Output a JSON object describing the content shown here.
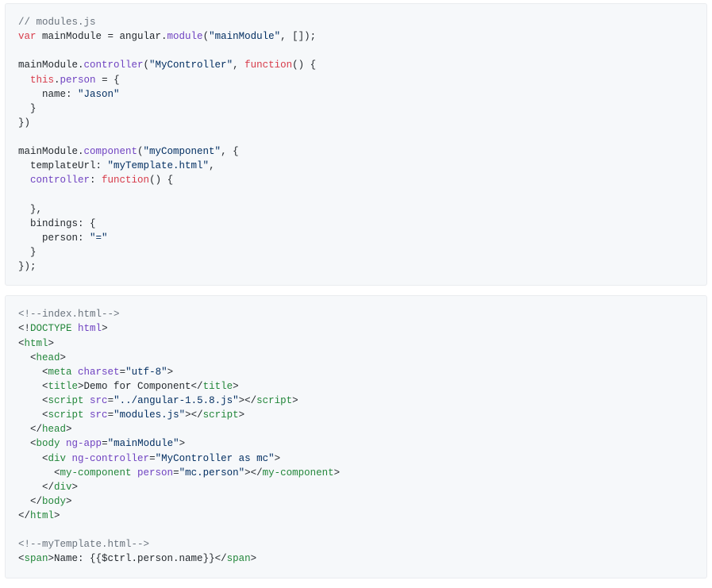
{
  "block1": {
    "l1_comment": "// modules.js",
    "l2_kw": "var",
    "l2_a": " mainModule = angular.",
    "l2_fn": "module",
    "l2_b": "(",
    "l2_s1": "\"mainModule\"",
    "l2_c": ", []);",
    "l3": "",
    "l4_a": "mainModule.",
    "l4_fn": "controller",
    "l4_b": "(",
    "l4_s1": "\"MyController\"",
    "l4_c": ", ",
    "l4_kw": "function",
    "l4_d": "() {",
    "l5_a": "  ",
    "l5_kw": "this",
    "l5_b": ".",
    "l5_attr": "person",
    "l5_c": " = {",
    "l6_a": "    name: ",
    "l6_s1": "\"Jason\"",
    "l7": "  }",
    "l8": "})",
    "l9": "",
    "l10_a": "mainModule.",
    "l10_fn": "component",
    "l10_b": "(",
    "l10_s1": "\"myComponent\"",
    "l10_c": ", {",
    "l11_a": "  templateUrl: ",
    "l11_s1": "\"myTemplate.html\"",
    "l11_b": ",",
    "l12_a": "  ",
    "l12_attr": "controller",
    "l12_b": ": ",
    "l12_kw": "function",
    "l12_c": "() {",
    "l13": "",
    "l14": "  },",
    "l15": "  bindings: {",
    "l16_a": "    person: ",
    "l16_s1": "\"=\"",
    "l17": "  }",
    "l18": "});"
  },
  "block2": {
    "l1_comment": "<!--index.html-->",
    "l2_a": "<!",
    "l2_tag": "DOCTYPE",
    "l2_b": " ",
    "l2_attr": "html",
    "l2_c": ">",
    "l3_a": "<",
    "l3_tag": "html",
    "l3_b": ">",
    "l4_a": "  <",
    "l4_tag": "head",
    "l4_b": ">",
    "l5_a": "    <",
    "l5_tag": "meta",
    "l5_b": " ",
    "l5_attr": "charset",
    "l5_c": "=",
    "l5_s1": "\"utf-8\"",
    "l5_d": ">",
    "l6_a": "    <",
    "l6_tag": "title",
    "l6_b": ">Demo for Component</",
    "l6_tag2": "title",
    "l6_c": ">",
    "l7_a": "    <",
    "l7_tag": "script",
    "l7_b": " ",
    "l7_attr": "src",
    "l7_c": "=",
    "l7_s1": "\"../angular-1.5.8.js\"",
    "l7_d": "></",
    "l7_tag2": "script",
    "l7_e": ">",
    "l8_a": "    <",
    "l8_tag": "script",
    "l8_b": " ",
    "l8_attr": "src",
    "l8_c": "=",
    "l8_s1": "\"modules.js\"",
    "l8_d": "></",
    "l8_tag2": "script",
    "l8_e": ">",
    "l9_a": "  </",
    "l9_tag": "head",
    "l9_b": ">",
    "l10_a": "  <",
    "l10_tag": "body",
    "l10_b": " ",
    "l10_attr": "ng-app",
    "l10_c": "=",
    "l10_s1": "\"mainModule\"",
    "l10_d": ">",
    "l11_a": "    <",
    "l11_tag": "div",
    "l11_b": " ",
    "l11_attr": "ng-controller",
    "l11_c": "=",
    "l11_s1": "\"MyController as mc\"",
    "l11_d": ">",
    "l12_a": "      <",
    "l12_tag": "my-component",
    "l12_b": " ",
    "l12_attr": "person",
    "l12_c": "=",
    "l12_s1": "\"mc.person\"",
    "l12_d": "></",
    "l12_tag2": "my-component",
    "l12_e": ">",
    "l13_a": "    </",
    "l13_tag": "div",
    "l13_b": ">",
    "l14_a": "  </",
    "l14_tag": "body",
    "l14_b": ">",
    "l15_a": "</",
    "l15_tag": "html",
    "l15_b": ">",
    "l16": "",
    "l17_comment": "<!--myTemplate.html-->",
    "l18_a": "<",
    "l18_tag": "span",
    "l18_b": ">Name: {{$ctrl.person.name}}</",
    "l18_tag2": "span",
    "l18_c": ">"
  }
}
